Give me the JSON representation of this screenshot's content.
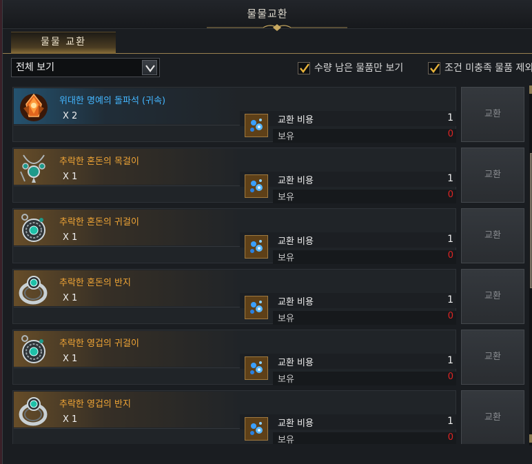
{
  "window": {
    "title": "물물교환"
  },
  "tabs": [
    {
      "label": "물물 교환"
    }
  ],
  "toolbar": {
    "filter_select": "전체 보기",
    "check1": "수량 남은 물품만 보기",
    "check2": "조건 미충족 물품 제외"
  },
  "cost_labels": {
    "cost": "교환 비용",
    "owned": "보유"
  },
  "exchange_button": "교환",
  "colors": {
    "blue_name": "#44b6ff",
    "gold_name": "#f0a536",
    "owned_zero": "#e02424"
  },
  "items": [
    {
      "name": "위대한 명예의 돌파석 (귀속)",
      "qty": "X 2",
      "cost": "1",
      "owned": "0",
      "icon": "honor-stone-icon",
      "tone": "blue"
    },
    {
      "name": "추락한 혼돈의 목걸이",
      "qty": "X 1",
      "cost": "1",
      "owned": "0",
      "icon": "necklace-icon",
      "tone": "gold"
    },
    {
      "name": "추락한 혼돈의 귀걸이",
      "qty": "X 1",
      "cost": "1",
      "owned": "0",
      "icon": "earring-icon",
      "tone": "gold"
    },
    {
      "name": "추락한 혼돈의 반지",
      "qty": "X 1",
      "cost": "1",
      "owned": "0",
      "icon": "ring-icon",
      "tone": "gold"
    },
    {
      "name": "추락한 영겁의 귀걸이",
      "qty": "X 1",
      "cost": "1",
      "owned": "0",
      "icon": "earring-icon",
      "tone": "gold"
    },
    {
      "name": "추락한 영겁의 반지",
      "qty": "X 1",
      "cost": "1",
      "owned": "0",
      "icon": "ring-icon",
      "tone": "gold"
    }
  ]
}
